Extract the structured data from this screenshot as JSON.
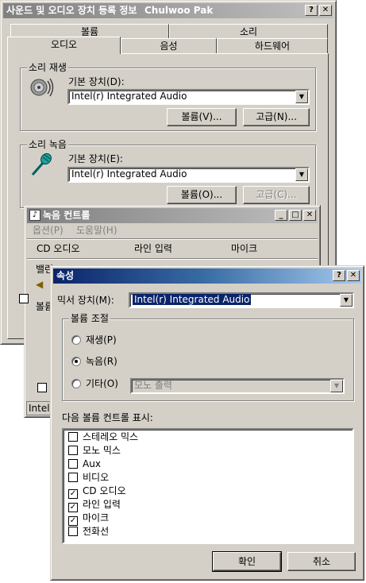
{
  "main_window": {
    "title": "사운드 및 오디오 장치 등록 정보",
    "title_overlay": "Chulwoo Pak",
    "tabs_back": [
      "볼륨",
      "소리"
    ],
    "tabs_front": [
      "오디오",
      "음성",
      "하드웨어"
    ],
    "playback": {
      "group_label": "소리 재생",
      "default_device_label": "기본 장치(D):",
      "device_value": "Intel(r) Integrated Audio",
      "volume_button": "볼륨(V)...",
      "advanced_button": "고급(N)..."
    },
    "recording": {
      "group_label": "소리 녹음",
      "default_device_label": "기본 장치(E):",
      "device_value": "Intel(r) Integrated Audio",
      "volume_button": "볼륨(O)...",
      "advanced_button": "고급(C)..."
    },
    "partial_labels": [
      "벨",
      "볼",
      "□"
    ]
  },
  "record_control": {
    "title": "녹음 컨트롤",
    "menu": [
      "옵션(P)",
      "도움말(H)"
    ],
    "columns": [
      "CD 오디오",
      "라인 입력",
      "마이크"
    ],
    "left_labels": [
      "밸런",
      "볼륨"
    ],
    "status": "Intel("
  },
  "properties": {
    "title": "속성",
    "mixer_label": "믹서 장치(M):",
    "mixer_value": "Intel(r) Integrated Audio",
    "adjust_group_label": "볼륨 조절",
    "radio_playback": "재생(P)",
    "radio_recording": "녹음(R)",
    "radio_other": "기타(O)",
    "other_combo_value": "모노 출력",
    "selected_radio": "recording",
    "list_label": "다음 볼륨 컨트롤 표시:",
    "items": [
      {
        "label": "스테레오 믹스",
        "checked": false
      },
      {
        "label": "모노 믹스",
        "checked": false
      },
      {
        "label": "Aux",
        "checked": false
      },
      {
        "label": "비디오",
        "checked": false
      },
      {
        "label": "CD 오디오",
        "checked": true
      },
      {
        "label": "라인 입력",
        "checked": true
      },
      {
        "label": "마이크",
        "checked": true
      },
      {
        "label": "전화선",
        "checked": false
      }
    ],
    "ok_button": "확인",
    "cancel_button": "취소"
  },
  "controls": {
    "help": "?",
    "close": "✕",
    "min": "_",
    "max": "□"
  }
}
